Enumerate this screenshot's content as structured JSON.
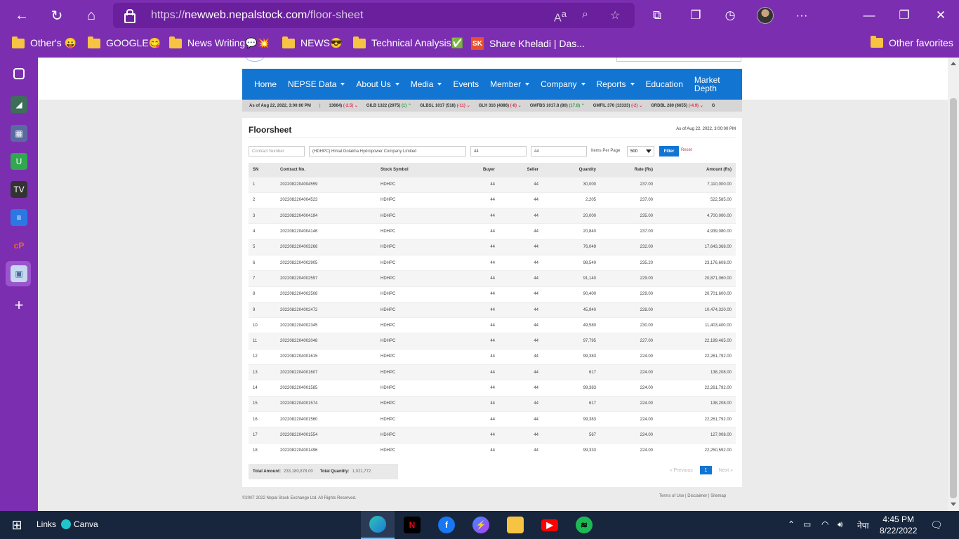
{
  "browser": {
    "url_prefix": "https://",
    "url_host": "newweb.nepalstock.com",
    "url_path": "/floor-sheet"
  },
  "favorites": [
    {
      "label": "Other's 😛",
      "icon": "folder-icon"
    },
    {
      "label": "GOOGLE😋",
      "icon": "folder-icon"
    },
    {
      "label": "News Writing💬💥",
      "icon": "folder-icon"
    },
    {
      "label": "NEWS😎",
      "icon": "folder-icon"
    },
    {
      "label": "Technical Analysis✅",
      "icon": "folder-icon"
    },
    {
      "label": "Share Kheladi | Das...",
      "icon": "sharekheladi-logo-icon"
    },
    {
      "label": "Other favorites",
      "icon": "folder-icon"
    }
  ],
  "nav": {
    "home": "Home",
    "nepse_data": "NEPSE Data",
    "about": "About Us",
    "media": "Media",
    "events": "Events",
    "member": "Member",
    "company": "Company",
    "reports": "Reports",
    "education": "Education",
    "market_depth_1": "Market",
    "market_depth_2": "Depth"
  },
  "ticker": {
    "asof": "As of Aug 22, 2022, 3:00:00 PM",
    "items": [
      {
        "text": "13664)",
        "change": "(-2.5)",
        "dir": "neg"
      },
      {
        "text": "GILB 1322 (2975)",
        "change": "(1)",
        "dir": "pos"
      },
      {
        "text": "GLBSL 1017 (518)",
        "change": "(-11)",
        "dir": "neg"
      },
      {
        "text": "GLH 316 (4086)",
        "change": "(-8)",
        "dir": "neg"
      },
      {
        "text": "GMFBS 1017.8 (80)",
        "change": "(17.8)",
        "dir": "pos"
      },
      {
        "text": "GMFIL 376 (13333)",
        "change": "(-2)",
        "dir": "neg"
      },
      {
        "text": "GRDBL 280 (6655)",
        "change": "(-4.9)",
        "dir": "neg"
      },
      {
        "text": "G",
        "change": "",
        "dir": ""
      }
    ]
  },
  "floorsheet": {
    "title": "Floorsheet",
    "asof": "As of Aug 22, 2022, 3:00:00 PM",
    "filters": {
      "contract_placeholder": "Contract Number",
      "company": "(HDHPC) Himal Dolakha Hydropower Company Limited",
      "buyer": "44",
      "seller": "44",
      "items_per_page_label": "Items Per Page",
      "items_per_page": "500",
      "filter_label": "Filter",
      "reset_label": "Reset"
    },
    "columns": [
      "SN",
      "Contract No.",
      "Stock Symbol",
      "Buyer",
      "Seller",
      "Quantity",
      "Rate (Rs)",
      "Amount (Rs)"
    ],
    "rows": [
      [
        "1",
        "2022082204004559",
        "HDHPC",
        "44",
        "44",
        "30,000",
        "237.00",
        "7,110,000.00"
      ],
      [
        "2",
        "2022082204004523",
        "HDHPC",
        "44",
        "44",
        "2,205",
        "237.00",
        "522,585.00"
      ],
      [
        "3",
        "2022082204004194",
        "HDHPC",
        "44",
        "44",
        "20,000",
        "235.00",
        "4,700,000.00"
      ],
      [
        "4",
        "2022082204004146",
        "HDHPC",
        "44",
        "44",
        "20,840",
        "237.00",
        "4,939,080.00"
      ],
      [
        "5",
        "2022082204003266",
        "HDHPC",
        "44",
        "44",
        "76,049",
        "232.00",
        "17,643,368.00"
      ],
      [
        "6",
        "2022082204002905",
        "HDHPC",
        "44",
        "44",
        "98,540",
        "235.20",
        "23,176,608.00"
      ],
      [
        "7",
        "2022082204002597",
        "HDHPC",
        "44",
        "44",
        "91,140",
        "229.00",
        "20,871,060.00"
      ],
      [
        "8",
        "2022082204002508",
        "HDHPC",
        "44",
        "44",
        "90,400",
        "229.00",
        "20,701,600.00"
      ],
      [
        "9",
        "2022082204002472",
        "HDHPC",
        "44",
        "44",
        "45,940",
        "228.00",
        "10,474,320.00"
      ],
      [
        "10",
        "2022082204002345",
        "HDHPC",
        "44",
        "44",
        "49,580",
        "230.00",
        "11,403,400.00"
      ],
      [
        "11",
        "2022082204002048",
        "HDHPC",
        "44",
        "44",
        "97,795",
        "227.00",
        "22,199,465.00"
      ],
      [
        "12",
        "2022082204001615",
        "HDHPC",
        "44",
        "44",
        "99,383",
        "224.00",
        "22,261,792.00"
      ],
      [
        "13",
        "2022082204001607",
        "HDHPC",
        "44",
        "44",
        "617",
        "224.00",
        "138,208.00"
      ],
      [
        "14",
        "2022082204001585",
        "HDHPC",
        "44",
        "44",
        "99,383",
        "224.00",
        "22,261,792.00"
      ],
      [
        "15",
        "2022082204001574",
        "HDHPC",
        "44",
        "44",
        "617",
        "224.00",
        "138,208.00"
      ],
      [
        "16",
        "2022082204001560",
        "HDHPC",
        "44",
        "44",
        "99,383",
        "224.00",
        "22,261,792.00"
      ],
      [
        "17",
        "2022082204001554",
        "HDHPC",
        "44",
        "44",
        "567",
        "224.00",
        "127,008.00"
      ],
      [
        "18",
        "2022082204001496",
        "HDHPC",
        "44",
        "44",
        "99,333",
        "224.00",
        "22,250,592.00"
      ]
    ],
    "totals": {
      "amount_label": "Total Amount:",
      "amount": "233,180,878.00",
      "quantity_label": "Total Quantity:",
      "quantity": "1,021,772"
    },
    "pager": {
      "prev": "« Previous",
      "current": "1",
      "next": "Next »"
    }
  },
  "footer": {
    "copyright": "©2007 2022 Nepal Stock Exchange Ltd. All Rights Reserved.",
    "links": "Terms of Use | Disclaimer | Sitemap"
  },
  "taskbar": {
    "links_label": "Links",
    "canva_label": "Canva",
    "lang": "नेपा",
    "time": "4:45 PM",
    "date": "8/22/2022"
  }
}
